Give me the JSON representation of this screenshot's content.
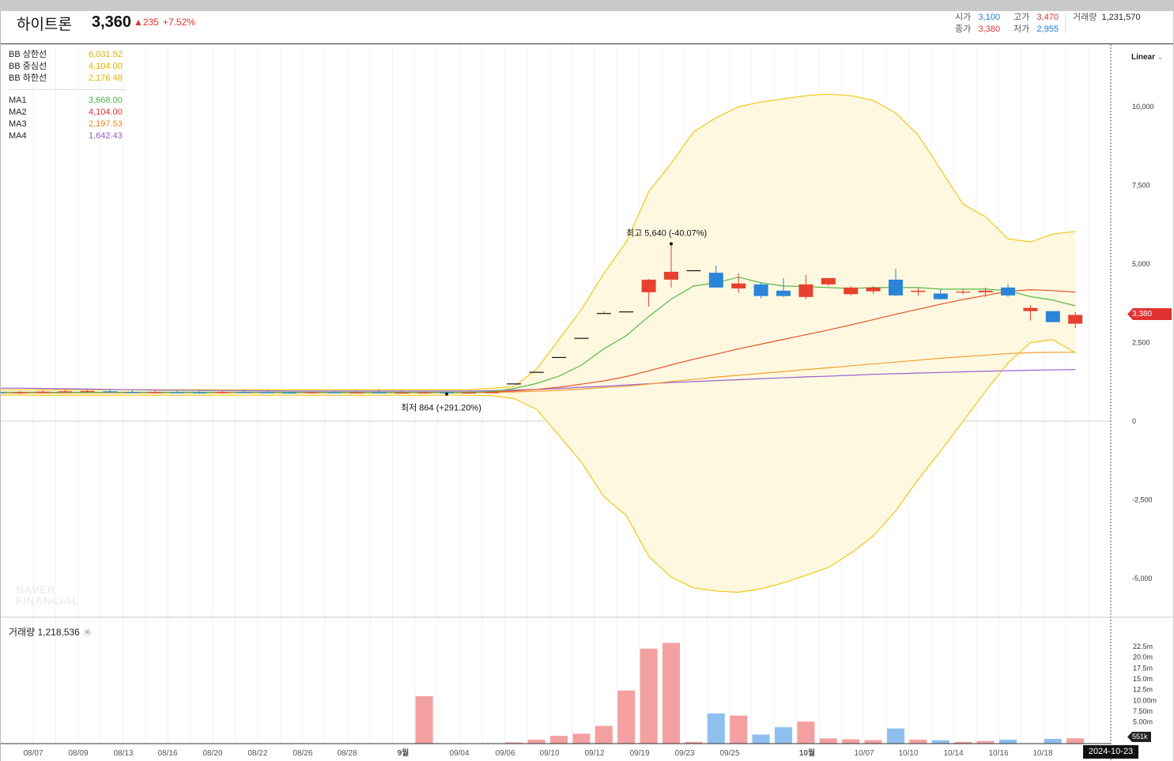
{
  "header": {
    "name": "하이트론",
    "price": "3,360",
    "change": "▲235",
    "change_pct": "+7.52%",
    "open_label": "시가",
    "open": "3,100",
    "close_label": "종가",
    "close": "3,380",
    "high_label": "고가",
    "high": "3,470",
    "low_label": "저가",
    "low": "2,955",
    "volume_label": "거래량",
    "volume": "1,231,570"
  },
  "legend": {
    "bb_upper_label": "BB 상한선",
    "bb_upper": "6,031.52",
    "bb_mid_label": "BB 중심선",
    "bb_mid": "4,104.00",
    "bb_lower_label": "BB 하한선",
    "bb_lower": "2,176.48",
    "ma1_label": "MA1",
    "ma1": "3,668.00",
    "ma2_label": "MA2",
    "ma2": "4,104.00",
    "ma3_label": "MA3",
    "ma3": "2,197.53",
    "ma4_label": "MA4",
    "ma4": "1,642.43"
  },
  "colors": {
    "up": "#e8402e",
    "down": "#2a84d8",
    "vol_up": "#f4a0a0",
    "vol_down": "#8ec0ef",
    "bb_band": "#f5c518",
    "bb_fill": "#fef8e0",
    "ma1": "#58b94a",
    "ma2": "#e6532c",
    "ma3": "#f0a030",
    "ma4": "#9a5fd0",
    "bb_upper_text": "#e0b000",
    "bb_mid_text": "#e0b000",
    "bb_lower_text": "#e0b000",
    "ma1_text": "#4caf50",
    "ma2_text": "#e03131",
    "ma3_text": "#e8862a",
    "ma4_text": "#8e5cc8"
  },
  "volume": {
    "label": "거래량",
    "value": "1,218,536",
    "close_icon": "close-icon",
    "badge": "551k",
    "ticks": [
      "22.5m",
      "20.0m",
      "17.5m",
      "15.0m",
      "12.5m",
      "10.00m",
      "7.50m",
      "5.00m"
    ]
  },
  "scale_mode": "Linear",
  "watermark": [
    "NAVER",
    "FINANCIAL"
  ],
  "date_badge": "2024-10-23",
  "price_badge": "3,380",
  "chart_data": {
    "type": "candlestick",
    "ylim": [
      -6200,
      10500
    ],
    "y_ticks": [
      "10,000",
      "7,500",
      "5,000",
      "2,500",
      "0",
      "-2,500",
      "-5,000"
    ],
    "x_tick_labels": [
      "08/07",
      "08/09",
      "08/13",
      "08/16",
      "08/20",
      "08/22",
      "08/26",
      "08/28",
      "9월",
      "09/04",
      "09/06",
      "09/10",
      "09/12",
      "09/19",
      "09/23",
      "09/25",
      "10월",
      "10/07",
      "10/10",
      "10/14",
      "10/16",
      "10/18"
    ],
    "annotations": {
      "high": {
        "text": "최고 5,640 (-40.07%)",
        "value": 5640
      },
      "low": {
        "text": "최저 864 (+291.20%)",
        "value": 864
      }
    },
    "candles": [
      {
        "o": 920,
        "h": 960,
        "l": 880,
        "c": 910
      },
      {
        "o": 910,
        "h": 950,
        "l": 870,
        "c": 920
      },
      {
        "o": 915,
        "h": 980,
        "l": 880,
        "c": 940
      },
      {
        "o": 930,
        "h": 990,
        "l": 890,
        "c": 950
      },
      {
        "o": 940,
        "h": 1000,
        "l": 900,
        "c": 960
      },
      {
        "o": 950,
        "h": 1010,
        "l": 900,
        "c": 935
      },
      {
        "o": 930,
        "h": 980,
        "l": 890,
        "c": 910
      },
      {
        "o": 910,
        "h": 960,
        "l": 880,
        "c": 925
      },
      {
        "o": 920,
        "h": 970,
        "l": 880,
        "c": 915
      },
      {
        "o": 915,
        "h": 950,
        "l": 870,
        "c": 905
      },
      {
        "o": 905,
        "h": 960,
        "l": 870,
        "c": 930
      },
      {
        "o": 930,
        "h": 980,
        "l": 890,
        "c": 920
      },
      {
        "o": 920,
        "h": 970,
        "l": 890,
        "c": 910
      },
      {
        "o": 910,
        "h": 950,
        "l": 880,
        "c": 905
      },
      {
        "o": 905,
        "h": 960,
        "l": 880,
        "c": 920
      },
      {
        "o": 920,
        "h": 970,
        "l": 885,
        "c": 910
      },
      {
        "o": 910,
        "h": 960,
        "l": 880,
        "c": 915
      },
      {
        "o": 915,
        "h": 1010,
        "l": 880,
        "c": 905
      },
      {
        "o": 905,
        "h": 960,
        "l": 880,
        "c": 910
      },
      {
        "o": 910,
        "h": 960,
        "l": 880,
        "c": 915
      },
      {
        "o": 915,
        "h": 930,
        "l": 864,
        "c": 905
      },
      {
        "o": 905,
        "h": 950,
        "l": 880,
        "c": 910
      },
      {
        "o": 910,
        "h": 960,
        "l": 890,
        "c": 920
      },
      {
        "o": 1200,
        "h": 1200,
        "l": 1200,
        "c": 1200
      },
      {
        "o": 1570,
        "h": 1570,
        "l": 1570,
        "c": 1570
      },
      {
        "o": 2040,
        "h": 2040,
        "l": 2040,
        "c": 2040
      },
      {
        "o": 2650,
        "h": 2650,
        "l": 2650,
        "c": 2650
      },
      {
        "o": 3440,
        "h": 3500,
        "l": 3440,
        "c": 3440
      },
      {
        "o": 3490,
        "h": 3490,
        "l": 3490,
        "c": 3490
      },
      {
        "o": 4100,
        "h": 4520,
        "l": 3650,
        "c": 4500
      },
      {
        "o": 4500,
        "h": 5640,
        "l": 4250,
        "c": 4750
      },
      {
        "o": 4800,
        "h": 4800,
        "l": 4800,
        "c": 4800
      },
      {
        "o": 4720,
        "h": 4950,
        "l": 4240,
        "c": 4250
      },
      {
        "o": 4220,
        "h": 4700,
        "l": 4080,
        "c": 4380
      },
      {
        "o": 4350,
        "h": 4420,
        "l": 3900,
        "c": 3980
      },
      {
        "o": 4150,
        "h": 4550,
        "l": 3950,
        "c": 3980
      },
      {
        "o": 3950,
        "h": 4650,
        "l": 3870,
        "c": 4350
      },
      {
        "o": 4350,
        "h": 4550,
        "l": 4300,
        "c": 4550
      },
      {
        "o": 4040,
        "h": 4300,
        "l": 4000,
        "c": 4250
      },
      {
        "o": 4130,
        "h": 4300,
        "l": 4050,
        "c": 4250
      },
      {
        "o": 4500,
        "h": 4850,
        "l": 3980,
        "c": 4000
      },
      {
        "o": 4110,
        "h": 4250,
        "l": 3980,
        "c": 4150
      },
      {
        "o": 4060,
        "h": 4200,
        "l": 3860,
        "c": 3880
      },
      {
        "o": 4100,
        "h": 4200,
        "l": 4040,
        "c": 4120
      },
      {
        "o": 4100,
        "h": 4250,
        "l": 3950,
        "c": 4150
      },
      {
        "o": 4250,
        "h": 4350,
        "l": 3950,
        "c": 4000
      },
      {
        "o": 3500,
        "h": 3690,
        "l": 3200,
        "c": 3600
      },
      {
        "o": 3500,
        "h": 3500,
        "l": 3150,
        "c": 3150
      },
      {
        "o": 3100,
        "h": 3470,
        "l": 2955,
        "c": 3380
      }
    ],
    "bb_upper": [
      1000,
      1000,
      1000,
      1000,
      1000,
      1000,
      1000,
      1000,
      1000,
      1000,
      1000,
      1000,
      1000,
      1000,
      1000,
      1000,
      1000,
      1000,
      1000,
      1000,
      1000,
      1000,
      1050,
      1100,
      1650,
      2600,
      3550,
      4700,
      5700,
      7300,
      8200,
      9200,
      9650,
      10000,
      10150,
      10250,
      10350,
      10400,
      10350,
      10200,
      9800,
      9100,
      8000,
      6900,
      6500,
      5800,
      5700,
      5950,
      6031.52
    ],
    "bb_mid": [
      910,
      910,
      910,
      912,
      913,
      914,
      914,
      914,
      914,
      914,
      914,
      914,
      914,
      914,
      914,
      914,
      914,
      914,
      914,
      914,
      914,
      914,
      930,
      960,
      1010,
      1080,
      1180,
      1280,
      1420,
      1600,
      1790,
      1970,
      2130,
      2300,
      2450,
      2600,
      2750,
      2900,
      3060,
      3230,
      3400,
      3560,
      3720,
      3870,
      4000,
      4130,
      4180,
      4150,
      4104
    ],
    "bb_lower": [
      830,
      830,
      825,
      825,
      825,
      825,
      825,
      825,
      825,
      825,
      825,
      825,
      825,
      825,
      825,
      825,
      825,
      825,
      825,
      825,
      825,
      825,
      810,
      720,
      380,
      -450,
      -1300,
      -2400,
      -3000,
      -4300,
      -4960,
      -5300,
      -5400,
      -5440,
      -5330,
      -5140,
      -4900,
      -4650,
      -4200,
      -3650,
      -2850,
      -1850,
      -950,
      0,
      950,
      1850,
      2500,
      2590,
      2176.48
    ],
    "ma1": [
      920,
      920,
      920,
      920,
      920,
      920,
      920,
      920,
      920,
      920,
      920,
      920,
      920,
      920,
      920,
      920,
      920,
      920,
      920,
      920,
      920,
      920,
      940,
      1040,
      1200,
      1430,
      1780,
      2300,
      2720,
      3330,
      3880,
      4300,
      4400,
      4580,
      4400,
      4300,
      4280,
      4250,
      4220,
      4250,
      4250,
      4250,
      4200,
      4200,
      4200,
      4150,
      3960,
      3850,
      3668
    ],
    "ma2": [
      910,
      910,
      910,
      912,
      913,
      914,
      914,
      914,
      914,
      914,
      914,
      914,
      914,
      914,
      914,
      914,
      914,
      914,
      914,
      914,
      914,
      914,
      930,
      960,
      1010,
      1080,
      1180,
      1280,
      1420,
      1600,
      1790,
      1970,
      2130,
      2300,
      2450,
      2600,
      2750,
      2900,
      3060,
      3230,
      3400,
      3560,
      3720,
      3870,
      4000,
      4130,
      4180,
      4150,
      4104
    ],
    "ma3": [
      900,
      900,
      900,
      902,
      903,
      904,
      904,
      904,
      904,
      904,
      904,
      904,
      904,
      904,
      904,
      904,
      904,
      904,
      904,
      904,
      904,
      904,
      915,
      930,
      950,
      980,
      1020,
      1070,
      1110,
      1180,
      1260,
      1330,
      1400,
      1460,
      1520,
      1580,
      1640,
      1700,
      1760,
      1820,
      1880,
      1940,
      2000,
      2050,
      2100,
      2150,
      2180,
      2190,
      2197.53
    ],
    "ma4": [
      1050,
      1050,
      1040,
      1030,
      1020,
      1010,
      1000,
      990,
      985,
      980,
      975,
      970,
      965,
      960,
      960,
      960,
      960,
      960,
      960,
      960,
      960,
      960,
      970,
      990,
      1010,
      1040,
      1080,
      1110,
      1150,
      1190,
      1230,
      1260,
      1290,
      1320,
      1350,
      1380,
      1410,
      1430,
      1460,
      1490,
      1510,
      1530,
      1550,
      1570,
      1590,
      1605,
      1620,
      1632,
      1642.43
    ],
    "volumes_m": [
      0.05,
      0.05,
      0.05,
      0.05,
      0.05,
      0.05,
      0.05,
      0.05,
      0.05,
      0.05,
      0.05,
      0.05,
      0.05,
      0.05,
      0.05,
      0.05,
      0.05,
      0.05,
      0.05,
      11.0,
      0.05,
      0.05,
      0.1,
      0.3,
      0.9,
      1.8,
      2.3,
      4.1,
      12.3,
      22.0,
      23.3,
      0.4,
      7.0,
      6.5,
      2.1,
      3.8,
      5.1,
      1.2,
      1.0,
      0.8,
      3.5,
      0.9,
      0.8,
      0.4,
      0.6,
      0.9,
      0.1,
      1.1,
      1.23
    ]
  }
}
